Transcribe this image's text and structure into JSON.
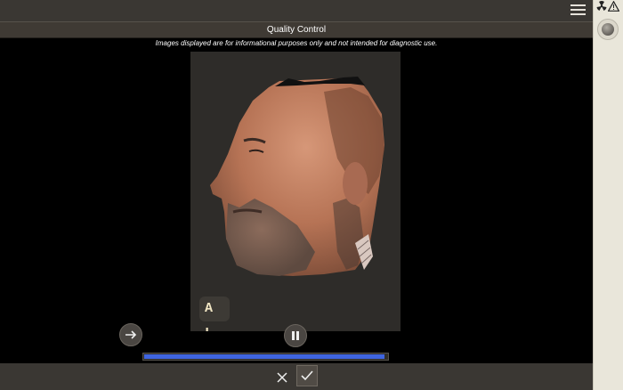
{
  "header": {
    "title": "Quality Control",
    "menu_icon": "hamburger-menu-icon"
  },
  "disclaimer": "Images displayed are for informational purposes only and not intended for diagnostic use.",
  "status_icons": [
    "radiation-icon",
    "warning-icon",
    "dial-icon"
  ],
  "viewer": {
    "orientation_label": "A L"
  },
  "controls": {
    "next_icon": "arrow-right-icon",
    "pause_icon": "pause-icon",
    "progress_fraction": 0.98
  },
  "footer": {
    "cancel_icon": "close-icon",
    "confirm_icon": "check-icon"
  },
  "colors": {
    "toolbar": "#3a3733",
    "sidebar": "#e9e6da",
    "progress": "#3f65e0",
    "viewer_bg": "#2e2c29"
  }
}
